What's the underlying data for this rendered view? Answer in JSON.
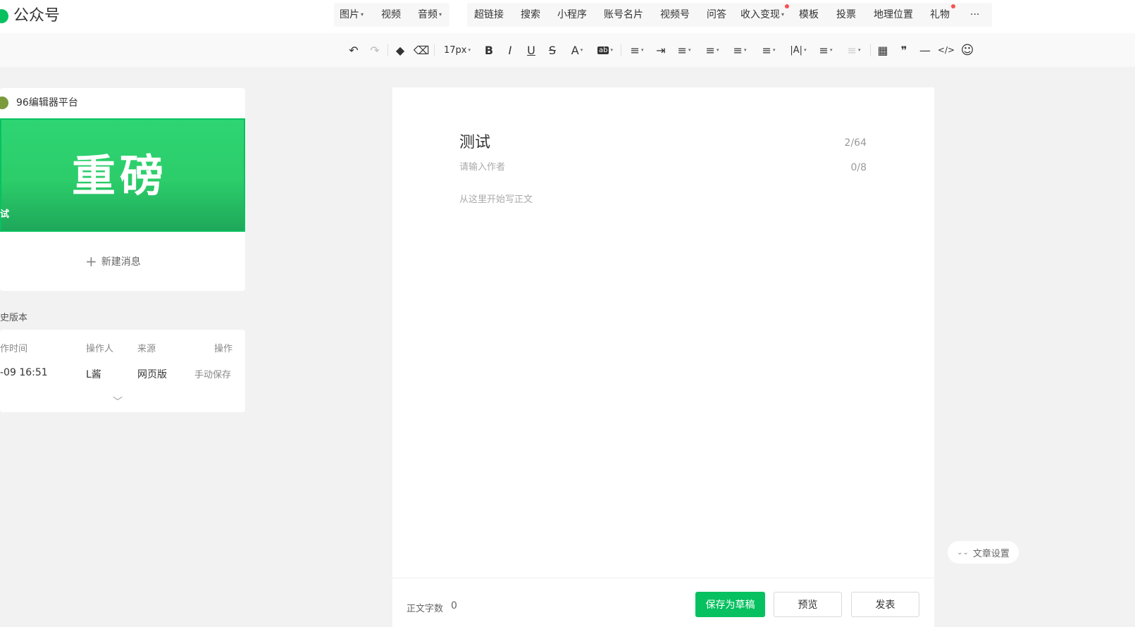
{
  "brand": {
    "name": "公众号"
  },
  "menu": {
    "media": [
      {
        "label": "图片",
        "dropdown": true
      },
      {
        "label": "视频",
        "dropdown": false
      },
      {
        "label": "音频",
        "dropdown": true
      }
    ],
    "tools": [
      {
        "label": "超链接"
      },
      {
        "label": "搜索"
      },
      {
        "label": "小程序"
      },
      {
        "label": "账号名片"
      },
      {
        "label": "视频号"
      },
      {
        "label": "问答"
      },
      {
        "label": "收入变现",
        "dropdown": true,
        "badge": true
      },
      {
        "label": "模板"
      },
      {
        "label": "投票"
      },
      {
        "label": "地理位置"
      },
      {
        "label": "礼物",
        "badge": true
      },
      {
        "label": "···"
      }
    ]
  },
  "toolbar": {
    "font_size": "17px",
    "icons": {
      "undo": "↶",
      "redo": "↷",
      "format_painter": "◆",
      "clear_format": "⌫",
      "bold": "B",
      "italic": "I",
      "underline": "U",
      "strike": "S",
      "font_color": "A",
      "bg_color": "ab",
      "align": "≡",
      "indent": "⇥",
      "table": "▦",
      "quote": "❞",
      "hr": "—",
      "code": "</>",
      "emoji": "☺"
    }
  },
  "sidebar": {
    "account_name": "96编辑器平台",
    "cover_title": "重磅",
    "cover_caption": "试",
    "new_message": "新建消息",
    "history": {
      "title": "史版本",
      "headers": [
        "作时间",
        "操作人",
        "来源",
        "操作"
      ],
      "rows": [
        [
          "-09 16:51",
          "L酱",
          "网页版",
          "手动保存"
        ]
      ]
    }
  },
  "editor": {
    "title": "测试",
    "title_count": "2/64",
    "author_placeholder": "请输入作者",
    "author_count": "0/8",
    "body_placeholder": "从这里开始写正文"
  },
  "footer": {
    "word_count_label": "正文字数",
    "word_count": "0",
    "save_draft": "保存为草稿",
    "preview": "预览",
    "publish": "发表"
  },
  "article_settings": "文章设置",
  "colors": {
    "accent": "#07c160",
    "badge": "#fa5151"
  }
}
